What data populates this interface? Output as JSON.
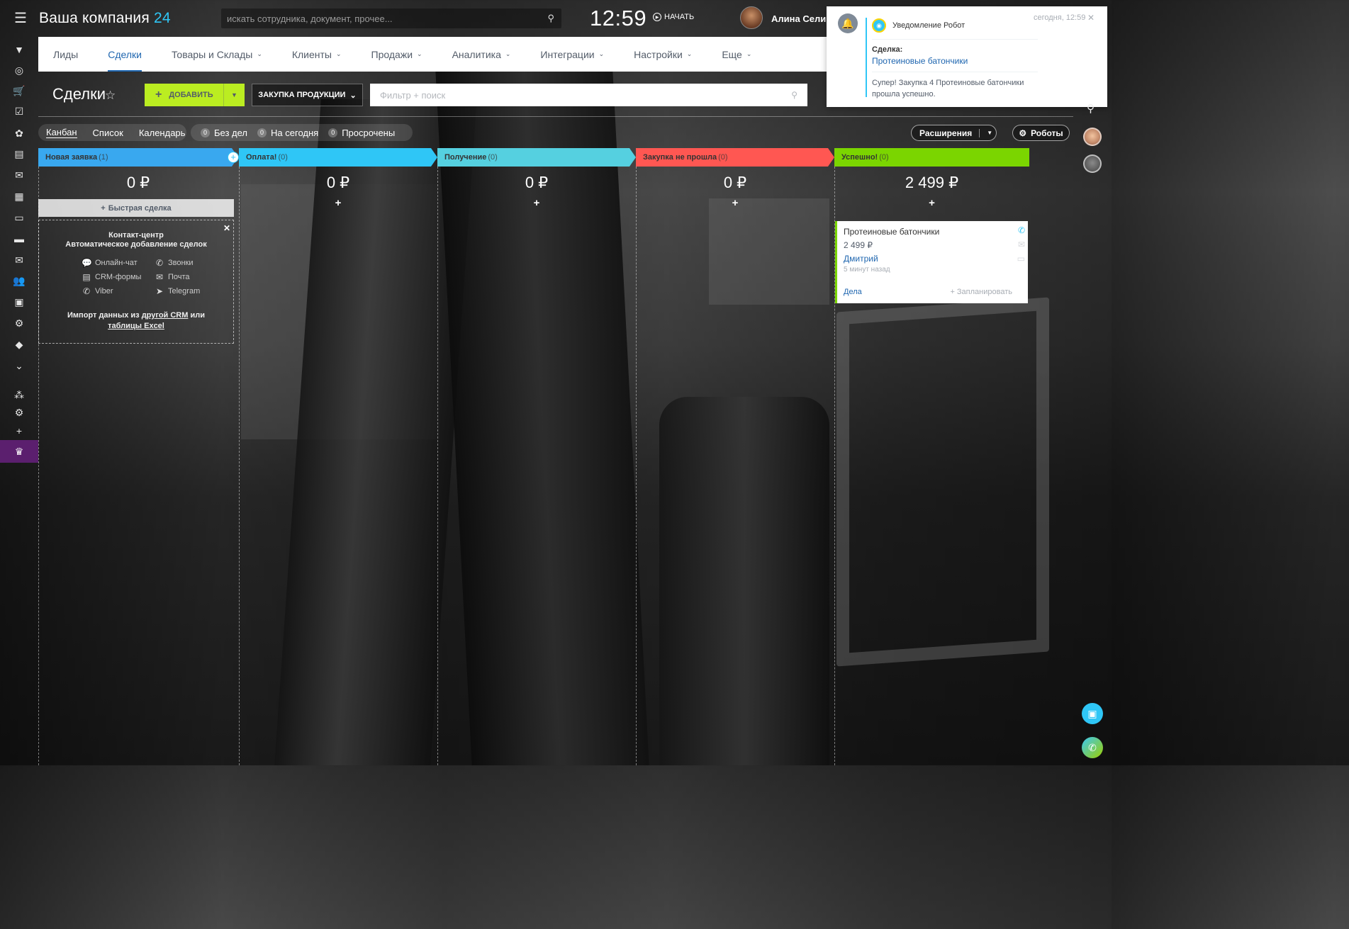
{
  "header": {
    "company": "Ваша компания",
    "company_suffix": "24",
    "search_placeholder": "искать сотрудника, документ, прочее...",
    "clock": "12:59",
    "start_label": "НАЧАТЬ",
    "user_name": "Алина Селив"
  },
  "nav": {
    "items": [
      {
        "label": "Лиды"
      },
      {
        "label": "Сделки"
      },
      {
        "label": "Товары и Склады"
      },
      {
        "label": "Клиенты"
      },
      {
        "label": "Продажи"
      },
      {
        "label": "Аналитика"
      },
      {
        "label": "Интеграции"
      },
      {
        "label": "Настройки"
      },
      {
        "label": "Еще"
      }
    ]
  },
  "page": {
    "title": "Сделки",
    "add_label": "ДОБАВИТЬ",
    "funnel_label": "ЗАКУПКА ПРОДУКЦИИ",
    "filter_placeholder": "Фильтр + поиск"
  },
  "views": {
    "kanban": "Канбан",
    "list": "Список",
    "calendar": "Календарь"
  },
  "counters": [
    {
      "count": "0",
      "label": "Без дел"
    },
    {
      "count": "0",
      "label": "На сегодня"
    },
    {
      "count": "0",
      "label": "Просрочены"
    }
  ],
  "toolbar": {
    "extensions": "Расширения",
    "robots": "Роботы"
  },
  "columns": [
    {
      "title": "Новая заявка",
      "count": "(1)",
      "sum": "0 ₽",
      "color": "#39a8ef"
    },
    {
      "title": "Оплата!",
      "count": "(0)",
      "sum": "0 ₽",
      "color": "#2fc6f6"
    },
    {
      "title": "Получение",
      "count": "(0)",
      "sum": "0 ₽",
      "color": "#55d0e0"
    },
    {
      "title": "Закупка не прошла",
      "count": "(0)",
      "sum": "0 ₽",
      "color": "#ff5752"
    },
    {
      "title": "Успешно!",
      "count": "(0)",
      "sum": "2 499 ₽",
      "color": "#7bd500"
    }
  ],
  "quick_deal": "Быстрая сделка",
  "contact_center": {
    "title": "Контакт-центр",
    "subtitle": "Автоматическое добавление сделок",
    "items": [
      "Онлайн-чат",
      "Звонки",
      "CRM-формы",
      "Почта",
      "Viber",
      "Telegram"
    ],
    "import_text_1": "Импорт данных из",
    "import_link_1": "другой CRM",
    "import_text_2": "или",
    "import_link_2": "таблицы Excel"
  },
  "deal_card": {
    "title": "Протеиновые батончики",
    "amount": "2 499 ₽",
    "client": "Дмитрий",
    "time": "5 минут назад",
    "activities": "Дела",
    "plan": "+ Запланировать"
  },
  "notification": {
    "from": "Уведомление Робот",
    "time": "сегодня, 12:59",
    "label": "Сделка:",
    "link": "Протеиновые батончики",
    "message": "Супер! Закупка 4 Протеиновые батончики прошла успешно."
  },
  "icons": {
    "menu": "hamburger-icon",
    "search": "search-icon",
    "bell": "bell-icon",
    "phone": "phone-icon"
  }
}
